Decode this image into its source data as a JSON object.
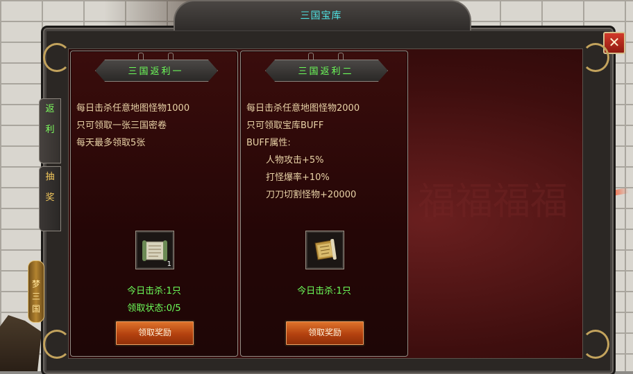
{
  "window": {
    "title": "三国宝库",
    "close_symbol": "✕"
  },
  "side_tabs": [
    {
      "chars": [
        "返",
        "利"
      ],
      "active": true
    },
    {
      "chars": [
        "抽",
        "奖"
      ],
      "active": false
    }
  ],
  "side_badge": {
    "chars": [
      "梦",
      "三",
      "国"
    ]
  },
  "background_watermark": "福福福福",
  "panels": [
    {
      "title": "三国返利一",
      "desc": [
        "每日击杀任意地图怪物1000",
        "只可领取一张三国密卷",
        "每天最多领取5张"
      ],
      "item": {
        "icon": "scroll-map-icon",
        "count": "1"
      },
      "kills": "今日击杀:1只",
      "claim_status": "领取状态:0/5",
      "button": "领取奖励"
    },
    {
      "title": "三国返利二",
      "desc": [
        "每日击杀任意地图怪物2000",
        "只可领取宝库BUFF",
        "BUFF属性:",
        "人物攻击+5%",
        "打怪爆率+10%",
        "刀刀切割怪物+20000"
      ],
      "item": {
        "icon": "golden-scroll-icon",
        "count": ""
      },
      "kills": "今日击杀:1只",
      "button": "领取奖励"
    }
  ],
  "colors": {
    "title": "#4fe3e4",
    "highlight_green": "#6dff5a",
    "desc_text": "#e9d3a7",
    "button_orange": "#c9561b",
    "panel_dark_red": "#2e0909"
  }
}
